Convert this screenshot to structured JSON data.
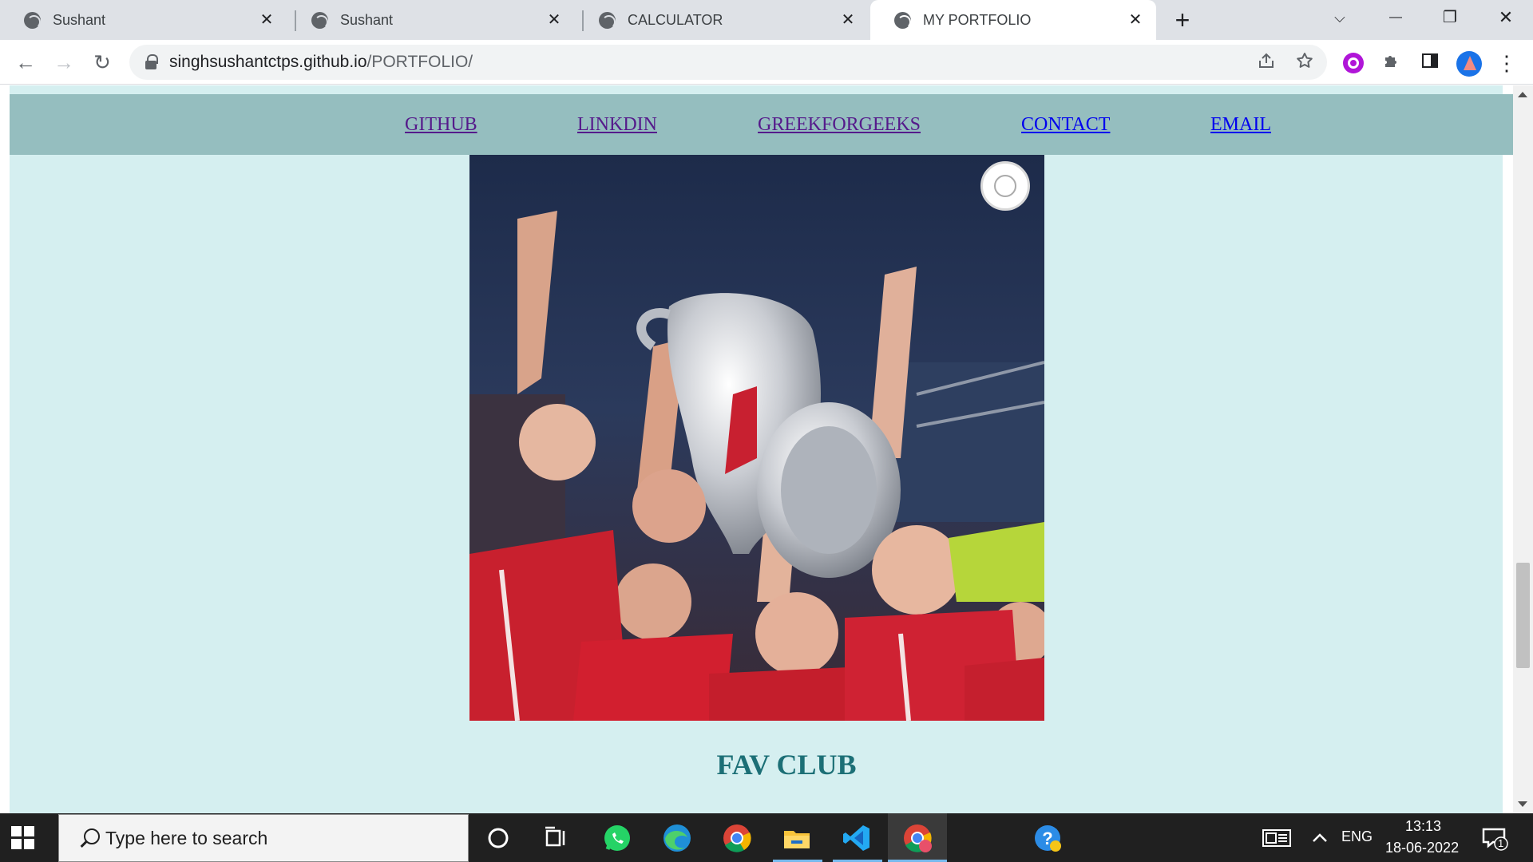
{
  "browser": {
    "tabs": [
      {
        "title": "Sushant"
      },
      {
        "title": "Sushant"
      },
      {
        "title": "CALCULATOR"
      },
      {
        "title": "MY PORTFOLIO",
        "active": true
      }
    ],
    "close_glyph": "✕",
    "new_tab_glyph": "+",
    "window": {
      "tab_search_glyph": "⌵",
      "minimize_glyph": "—",
      "restore_glyph": "❐",
      "close_glyph": "✕"
    },
    "nav": {
      "back_glyph": "←",
      "forward_glyph": "→",
      "reload_glyph": "↻"
    },
    "url": {
      "domain": "singhsushantctps.github.io",
      "path": "/PORTFOLIO/"
    },
    "omnibox_icons": [
      "share-icon",
      "bookmark-star-icon"
    ],
    "extension_icons": [
      "purple-extension-icon",
      "puzzle-icon",
      "side-panel-icon"
    ],
    "menu_glyph": "⋮"
  },
  "page": {
    "nav_links": [
      {
        "label": "GITHUB",
        "visited": true
      },
      {
        "label": "LINKDIN",
        "visited": true
      },
      {
        "label": "GREEKFORGEEKS",
        "visited": true
      },
      {
        "label": "CONTACT",
        "visited": false
      },
      {
        "label": "EMAIL",
        "visited": false
      }
    ],
    "heading": "FAV CLUB",
    "colors": {
      "background": "#d5eff0",
      "navbar": "#95bebf",
      "heading": "#1c6f76",
      "link": "#0000ee",
      "visited_link": "#551a8b"
    }
  },
  "taskbar": {
    "search_placeholder": "Type here to search",
    "apps": [
      "cortana-icon",
      "task-view-icon",
      "whatsapp-icon",
      "edge-icon",
      "chrome-icon",
      "file-explorer-icon",
      "vscode-icon",
      "chrome-active-icon",
      "help-icon"
    ],
    "language": "ENG",
    "time": "13:13",
    "date": "18-06-2022",
    "notification_count": "1"
  }
}
